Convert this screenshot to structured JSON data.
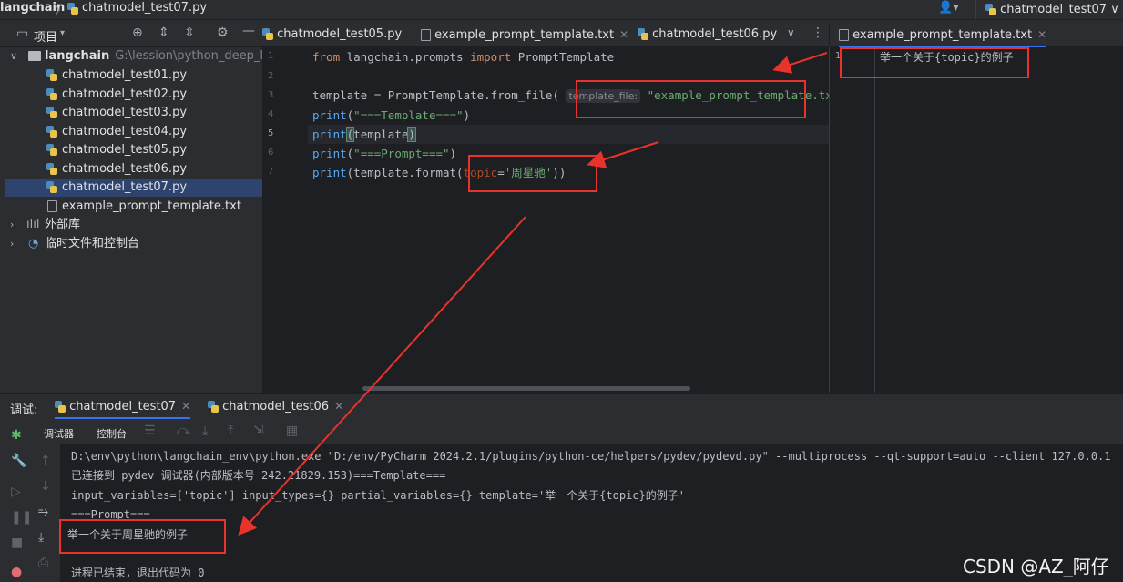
{
  "navbar": {
    "project": "langchain",
    "separator": "〉",
    "file": "chatmodel_test07.py",
    "run_config": "chatmodel_test07 ∨",
    "user_icon": "user-icon"
  },
  "project_panel": {
    "title": "项目",
    "root_name": "langchain",
    "root_path": "G:\\lession\\python_deep_lea",
    "files": [
      {
        "name": "chatmodel_test01.py",
        "type": "py"
      },
      {
        "name": "chatmodel_test02.py",
        "type": "py"
      },
      {
        "name": "chatmodel_test03.py",
        "type": "py"
      },
      {
        "name": "chatmodel_test04.py",
        "type": "py"
      },
      {
        "name": "chatmodel_test05.py",
        "type": "py"
      },
      {
        "name": "chatmodel_test06.py",
        "type": "py"
      },
      {
        "name": "chatmodel_test07.py",
        "type": "py",
        "selected": true
      },
      {
        "name": "example_prompt_template.txt",
        "type": "txt"
      }
    ],
    "external_libs": "外部库",
    "scratches": "临时文件和控制台"
  },
  "editor_tabs": [
    {
      "label": "chatmodel_test05.py"
    },
    {
      "label": "example_prompt_template.txt"
    },
    {
      "label": "chatmodel_test06.py"
    }
  ],
  "editor": {
    "line_numbers": [
      "1",
      "2",
      "3",
      "4",
      "5",
      "6",
      "7"
    ],
    "line1": {
      "kw1": "from",
      "mod": " langchain.prompts ",
      "kw2": "import",
      "cls": " PromptTemplate"
    },
    "line3": {
      "pre": "template = PromptTemplate.from_file( ",
      "hint": "template_file:",
      "str": " \"example_prompt_template.txt\""
    },
    "line4": {
      "fn": "print",
      "open": "(",
      "str": "\"===Template===\"",
      "close": ")"
    },
    "line5": {
      "fn": "print",
      "open": "(",
      "arg": "template",
      "close": ")"
    },
    "line6": {
      "fn": "print",
      "open": "(",
      "str": "\"===Prompt===\"",
      "close": ")"
    },
    "line7": {
      "fn": "print",
      "pre": "(template.format(",
      "param": "topic",
      "eq": "=",
      "str": "'周星驰'",
      "close": "))"
    }
  },
  "txt_pane": {
    "tab": "example_prompt_template.txt",
    "line_number": "1",
    "content": "举一个关于{topic}的例子"
  },
  "debug": {
    "label": "调试:",
    "tabs": [
      {
        "label": "chatmodel_test07"
      },
      {
        "label": "chatmodel_test06"
      }
    ],
    "subtabs": [
      "调试器",
      "控制台"
    ],
    "console_lines": [
      "D:\\env\\python\\langchain_env\\python.exe \"D:/env/PyCharm 2024.2.1/plugins/python-ce/helpers/pydev/pydevd.py\" --multiprocess --qt-support=auto --client 127.0.0.1",
      "已连接到 pydev 调试器(内部版本号 242.21829.153)===Template===",
      "input_variables=['topic'] input_types={} partial_variables={} template='举一个关于{topic}的例子'",
      "===Prompt===",
      "举一个关于周星驰的例子",
      "",
      "进程已结束，退出代码为 0"
    ]
  },
  "watermark": "CSDN @AZ_阿仔",
  "colors": {
    "accent": "#3574f0",
    "annotation": "#e8322c",
    "selection": "#2e436e"
  }
}
